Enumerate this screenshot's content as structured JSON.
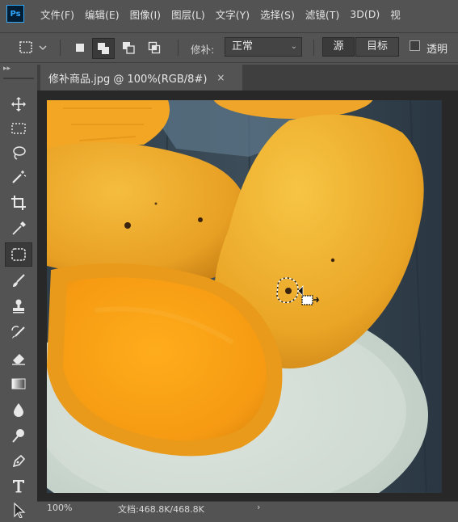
{
  "app": {
    "logo": "Ps"
  },
  "menu": [
    "文件(F)",
    "编辑(E)",
    "图像(I)",
    "图层(L)",
    "文字(Y)",
    "选择(S)",
    "滤镜(T)",
    "3D(D)",
    "视"
  ],
  "options": {
    "patch_label": "修补:",
    "patch_mode": "正常",
    "source_label": "源",
    "target_label": "目标",
    "transparent_label": "透明",
    "transparent_checked": false
  },
  "document": {
    "tab_title": "修补商品.jpg @ 100%(RGB/8#)",
    "close_glyph": "×"
  },
  "status": {
    "zoom": "100%",
    "doc_size": "文档:468.8K/468.8K",
    "arrow": "›"
  },
  "tools": [
    {
      "name": "move-tool",
      "icon": "move-icon"
    },
    {
      "name": "marquee-tool",
      "icon": "rect-marquee-icon"
    },
    {
      "name": "lasso-tool",
      "icon": "lasso-icon"
    },
    {
      "name": "magic-wand-tool",
      "icon": "magic-wand-icon"
    },
    {
      "name": "crop-tool",
      "icon": "crop-icon"
    },
    {
      "name": "eyedropper-tool",
      "icon": "eyedropper-icon"
    },
    {
      "name": "patch-tool",
      "icon": "patch-icon",
      "active": true
    },
    {
      "name": "brush-tool",
      "icon": "brush-icon"
    },
    {
      "name": "stamp-tool",
      "icon": "stamp-icon"
    },
    {
      "name": "history-brush-tool",
      "icon": "history-brush-icon"
    },
    {
      "name": "eraser-tool",
      "icon": "eraser-icon"
    },
    {
      "name": "gradient-tool",
      "icon": "gradient-icon"
    },
    {
      "name": "blur-tool",
      "icon": "blur-icon"
    },
    {
      "name": "dodge-tool",
      "icon": "dodge-icon"
    },
    {
      "name": "pen-tool",
      "icon": "pen-icon"
    },
    {
      "name": "type-tool",
      "icon": "type-icon"
    },
    {
      "name": "path-select-tool",
      "icon": "path-select-icon"
    }
  ],
  "colors": {
    "ui_bg": "#535353",
    "panel_dark": "#3f3f3f",
    "ps_blue": "#31a8ff",
    "mango": "#f0a92e",
    "plate": "#cdd8cf",
    "table": "#34424d"
  }
}
